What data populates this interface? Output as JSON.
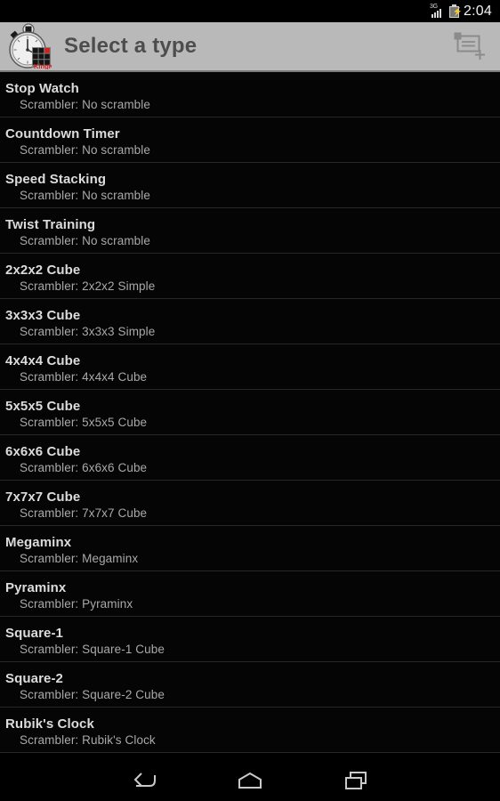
{
  "status_bar": {
    "network_label": "3G",
    "signal_icon": "signal-bars-icon",
    "battery_icon": "battery-charging-icon",
    "time": "2:04"
  },
  "action_bar": {
    "app_icon": "stopwatch-cube-app-icon",
    "app_icon_brand": "KingKo",
    "title": "Select a type",
    "action_icon": "add-new-icon",
    "action_label": "New",
    "background_color": "#b9b9b9",
    "title_color": "#4d4d4d"
  },
  "list": {
    "scrambler_prefix": "Scrambler: ",
    "items": [
      {
        "title": "Stop Watch",
        "subtitle": "Scrambler: No scramble"
      },
      {
        "title": "Countdown Timer",
        "subtitle": "Scrambler: No scramble"
      },
      {
        "title": "Speed Stacking",
        "subtitle": "Scrambler: No scramble"
      },
      {
        "title": "Twist Training",
        "subtitle": "Scrambler: No scramble"
      },
      {
        "title": "2x2x2 Cube",
        "subtitle": "Scrambler: 2x2x2 Simple"
      },
      {
        "title": "3x3x3 Cube",
        "subtitle": "Scrambler: 3x3x3 Simple"
      },
      {
        "title": "4x4x4 Cube",
        "subtitle": "Scrambler: 4x4x4 Cube"
      },
      {
        "title": "5x5x5 Cube",
        "subtitle": "Scrambler: 5x5x5 Cube"
      },
      {
        "title": "6x6x6 Cube",
        "subtitle": "Scrambler: 6x6x6 Cube"
      },
      {
        "title": "7x7x7 Cube",
        "subtitle": "Scrambler: 7x7x7 Cube"
      },
      {
        "title": "Megaminx",
        "subtitle": "Scrambler: Megaminx"
      },
      {
        "title": "Pyraminx",
        "subtitle": "Scrambler: Pyraminx"
      },
      {
        "title": "Square-1",
        "subtitle": "Scrambler: Square-1 Cube"
      },
      {
        "title": "Square-2",
        "subtitle": "Scrambler: Square-2 Cube"
      },
      {
        "title": "Rubik's Clock",
        "subtitle": "Scrambler: Rubik's Clock"
      }
    ]
  },
  "nav_bar": {
    "back_icon": "back-arrow-icon",
    "home_icon": "home-icon",
    "recents_icon": "recent-apps-icon"
  },
  "theme": {
    "background": "#000000",
    "row_title_color": "#dcdcdc",
    "row_subtitle_color": "#a9a9a9",
    "divider_color": "#272727",
    "accent_red": "#d81d1d"
  }
}
